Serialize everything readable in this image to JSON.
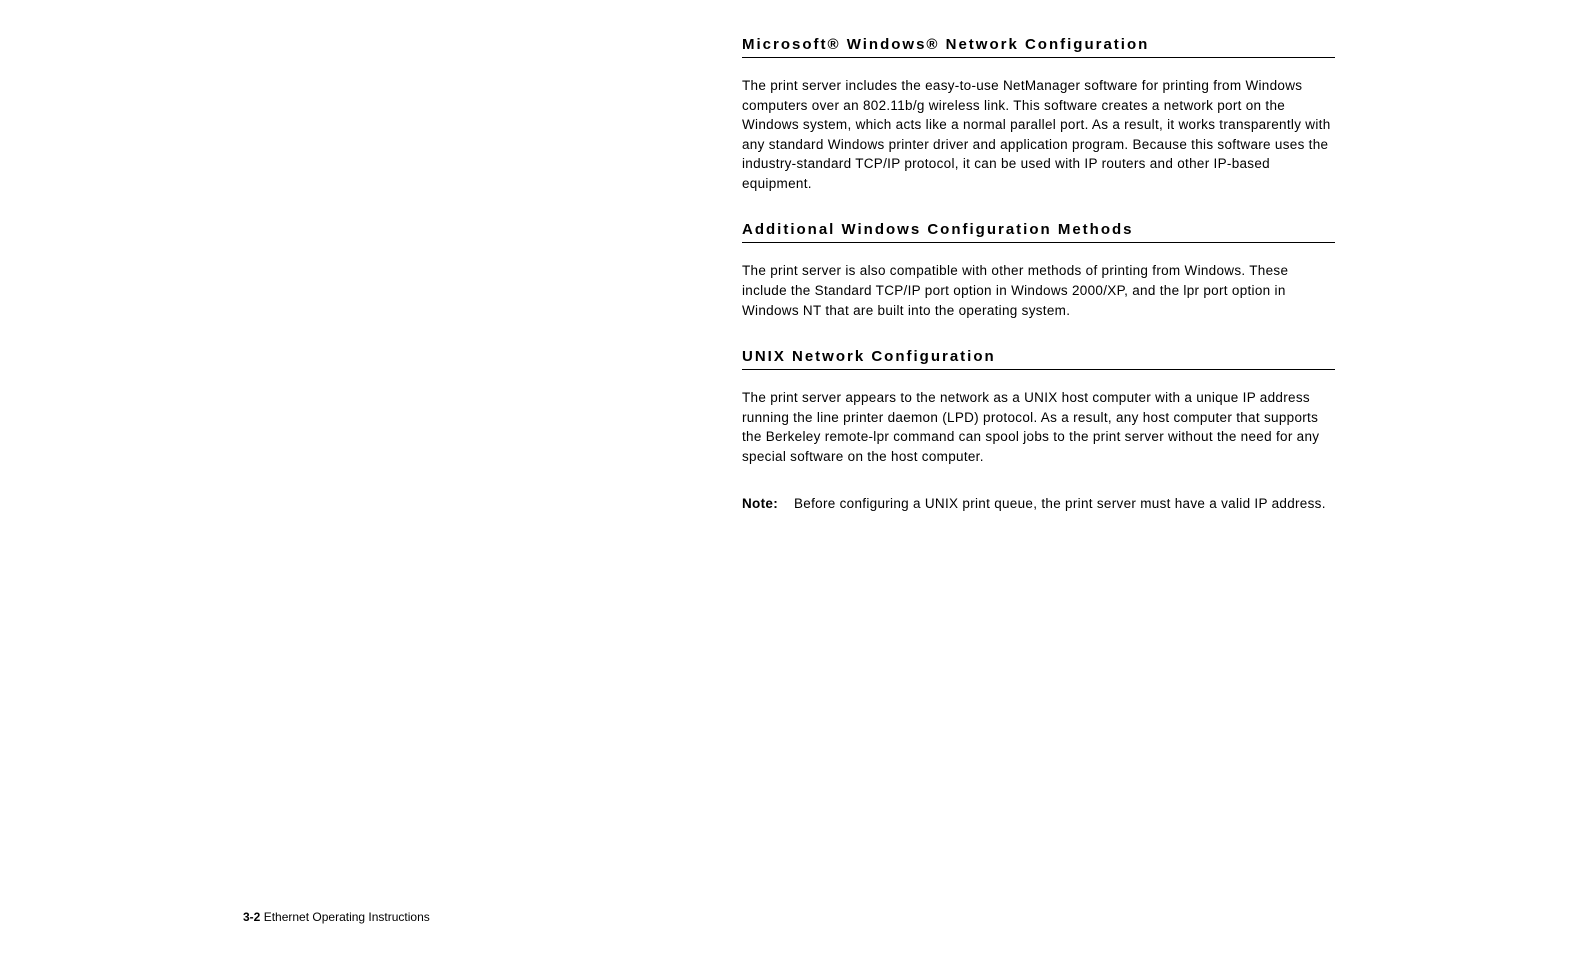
{
  "sections": {
    "section1": {
      "heading": "Microsoft® Windows® Network Configuration",
      "body": "The print server includes the easy-to-use NetManager software for printing from Windows computers over an 802.11b/g wireless link.  This software creates a network port on the Windows system, which acts like a normal parallel port.  As a result, it works transparently with any standard Windows printer driver and application program.  Because this software uses the industry-standard TCP/IP protocol, it can be used with IP routers and other IP-based equipment."
    },
    "section2": {
      "heading": "Additional Windows Configuration Methods",
      "body": "The print server is also compatible with other methods of printing from Windows.  These include the Standard TCP/IP port option in Windows 2000/XP, and the lpr port option in Windows NT that are built into the operating system."
    },
    "section3": {
      "heading": "UNIX Network Configuration",
      "body": "The print server appears to the network as a UNIX host computer with a unique IP address running the line printer daemon (LPD) protocol.  As a result, any host computer that supports the Berkeley remote-lpr command can spool jobs to the print server without the need for any special software on the host computer.",
      "note_label": "Note:",
      "note_text": "Before configuring a UNIX print queue, the print server must have a valid IP address."
    }
  },
  "footer": {
    "page_number": "3-2",
    "title": "Ethernet Operating Instructions"
  }
}
